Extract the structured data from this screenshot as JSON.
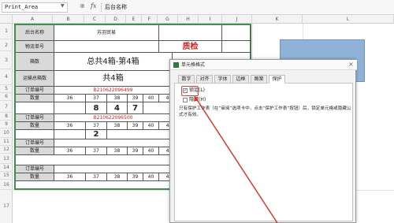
{
  "formula_bar": {
    "name_box": "Print_Area",
    "formula": "后台名称"
  },
  "columns": [
    "A",
    "B",
    "C",
    "D",
    "E",
    "F",
    "G",
    "H",
    "I",
    "J",
    "K",
    "L"
  ],
  "rows": [
    "1",
    "2",
    "3",
    "4",
    "5",
    "6",
    "7",
    "8",
    "9",
    "10",
    "11",
    "12",
    "13",
    "14",
    "15",
    "16",
    "17"
  ],
  "table": {
    "r1_label": "后台名称",
    "r1_value": "苏羽贸易",
    "r2_label": "物流单号",
    "r2_stamp": "质检",
    "r3_label": "箱数",
    "r3_value": "总共4箱-第4箱",
    "r4_label": "运输总箱数",
    "r4_value": "共4箱",
    "order_label": "订单编号",
    "qty_label": "数量",
    "order1": "B210622096499",
    "order2": "B210622096500",
    "sizes": [
      "36",
      "37",
      "38",
      "39",
      "40",
      "41"
    ],
    "qty1": [
      "8",
      "4",
      "7"
    ],
    "qty2": [
      "2"
    ]
  },
  "dialog": {
    "title": "单元格格式",
    "close": "×",
    "tabs": [
      "数字",
      "对齐",
      "字体",
      "边框",
      "图案",
      "保护"
    ],
    "active_tab": "保护",
    "locked_label": "锁定(L)",
    "locked_checked": "✓",
    "hidden_label": "隐藏(H)",
    "note": "只有保护工作表（在“审阅”选项卡中，点击“保护工作表”按钮）后，锁定单元格或隐藏公式才有效。"
  },
  "colors": {
    "accent_red": "#d42020",
    "table_border": "#3f8f4f",
    "blue_box": "#8fb2d8"
  }
}
